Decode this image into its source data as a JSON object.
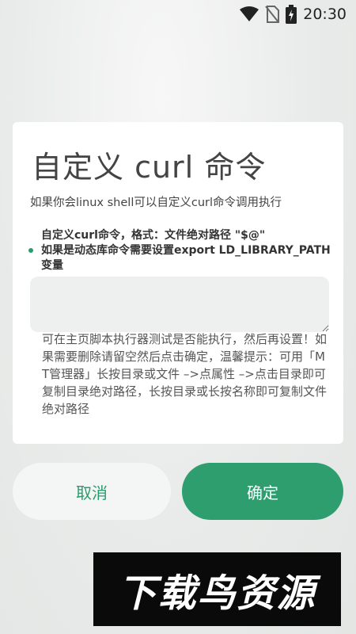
{
  "status_bar": {
    "time": "20:30",
    "icons": [
      "wifi-icon",
      "no-sim-icon",
      "battery-charging-icon"
    ]
  },
  "dialog": {
    "title": "自定义 curl 命令",
    "subtitle": "如果你会linux shell可以自定义curl命令调用执行",
    "hint_line1": "自定义curl命令，格式：文件绝对路径 \"$@\"",
    "hint_line2": "如果是动态库命令需要设置export LD_LIBRARY_PATH变量",
    "input": {
      "value": "",
      "placeholder": ""
    },
    "note": "可在主页脚本执行器测试是否能执行，然后再设置！如果需要删除请留空然后点击确定，温馨提示：可用「MT管理器」长按目录或文件 –>点属性 –>点击目录即可复制目录绝对路径，长按目录或长按名称即可复制文件绝对路径"
  },
  "buttons": {
    "cancel": "取消",
    "confirm": "确定"
  },
  "watermark": "下载鸟资源",
  "colors": {
    "accent": "#2e9e6f",
    "background": "#e9ebea",
    "dialog": "#ffffff"
  }
}
